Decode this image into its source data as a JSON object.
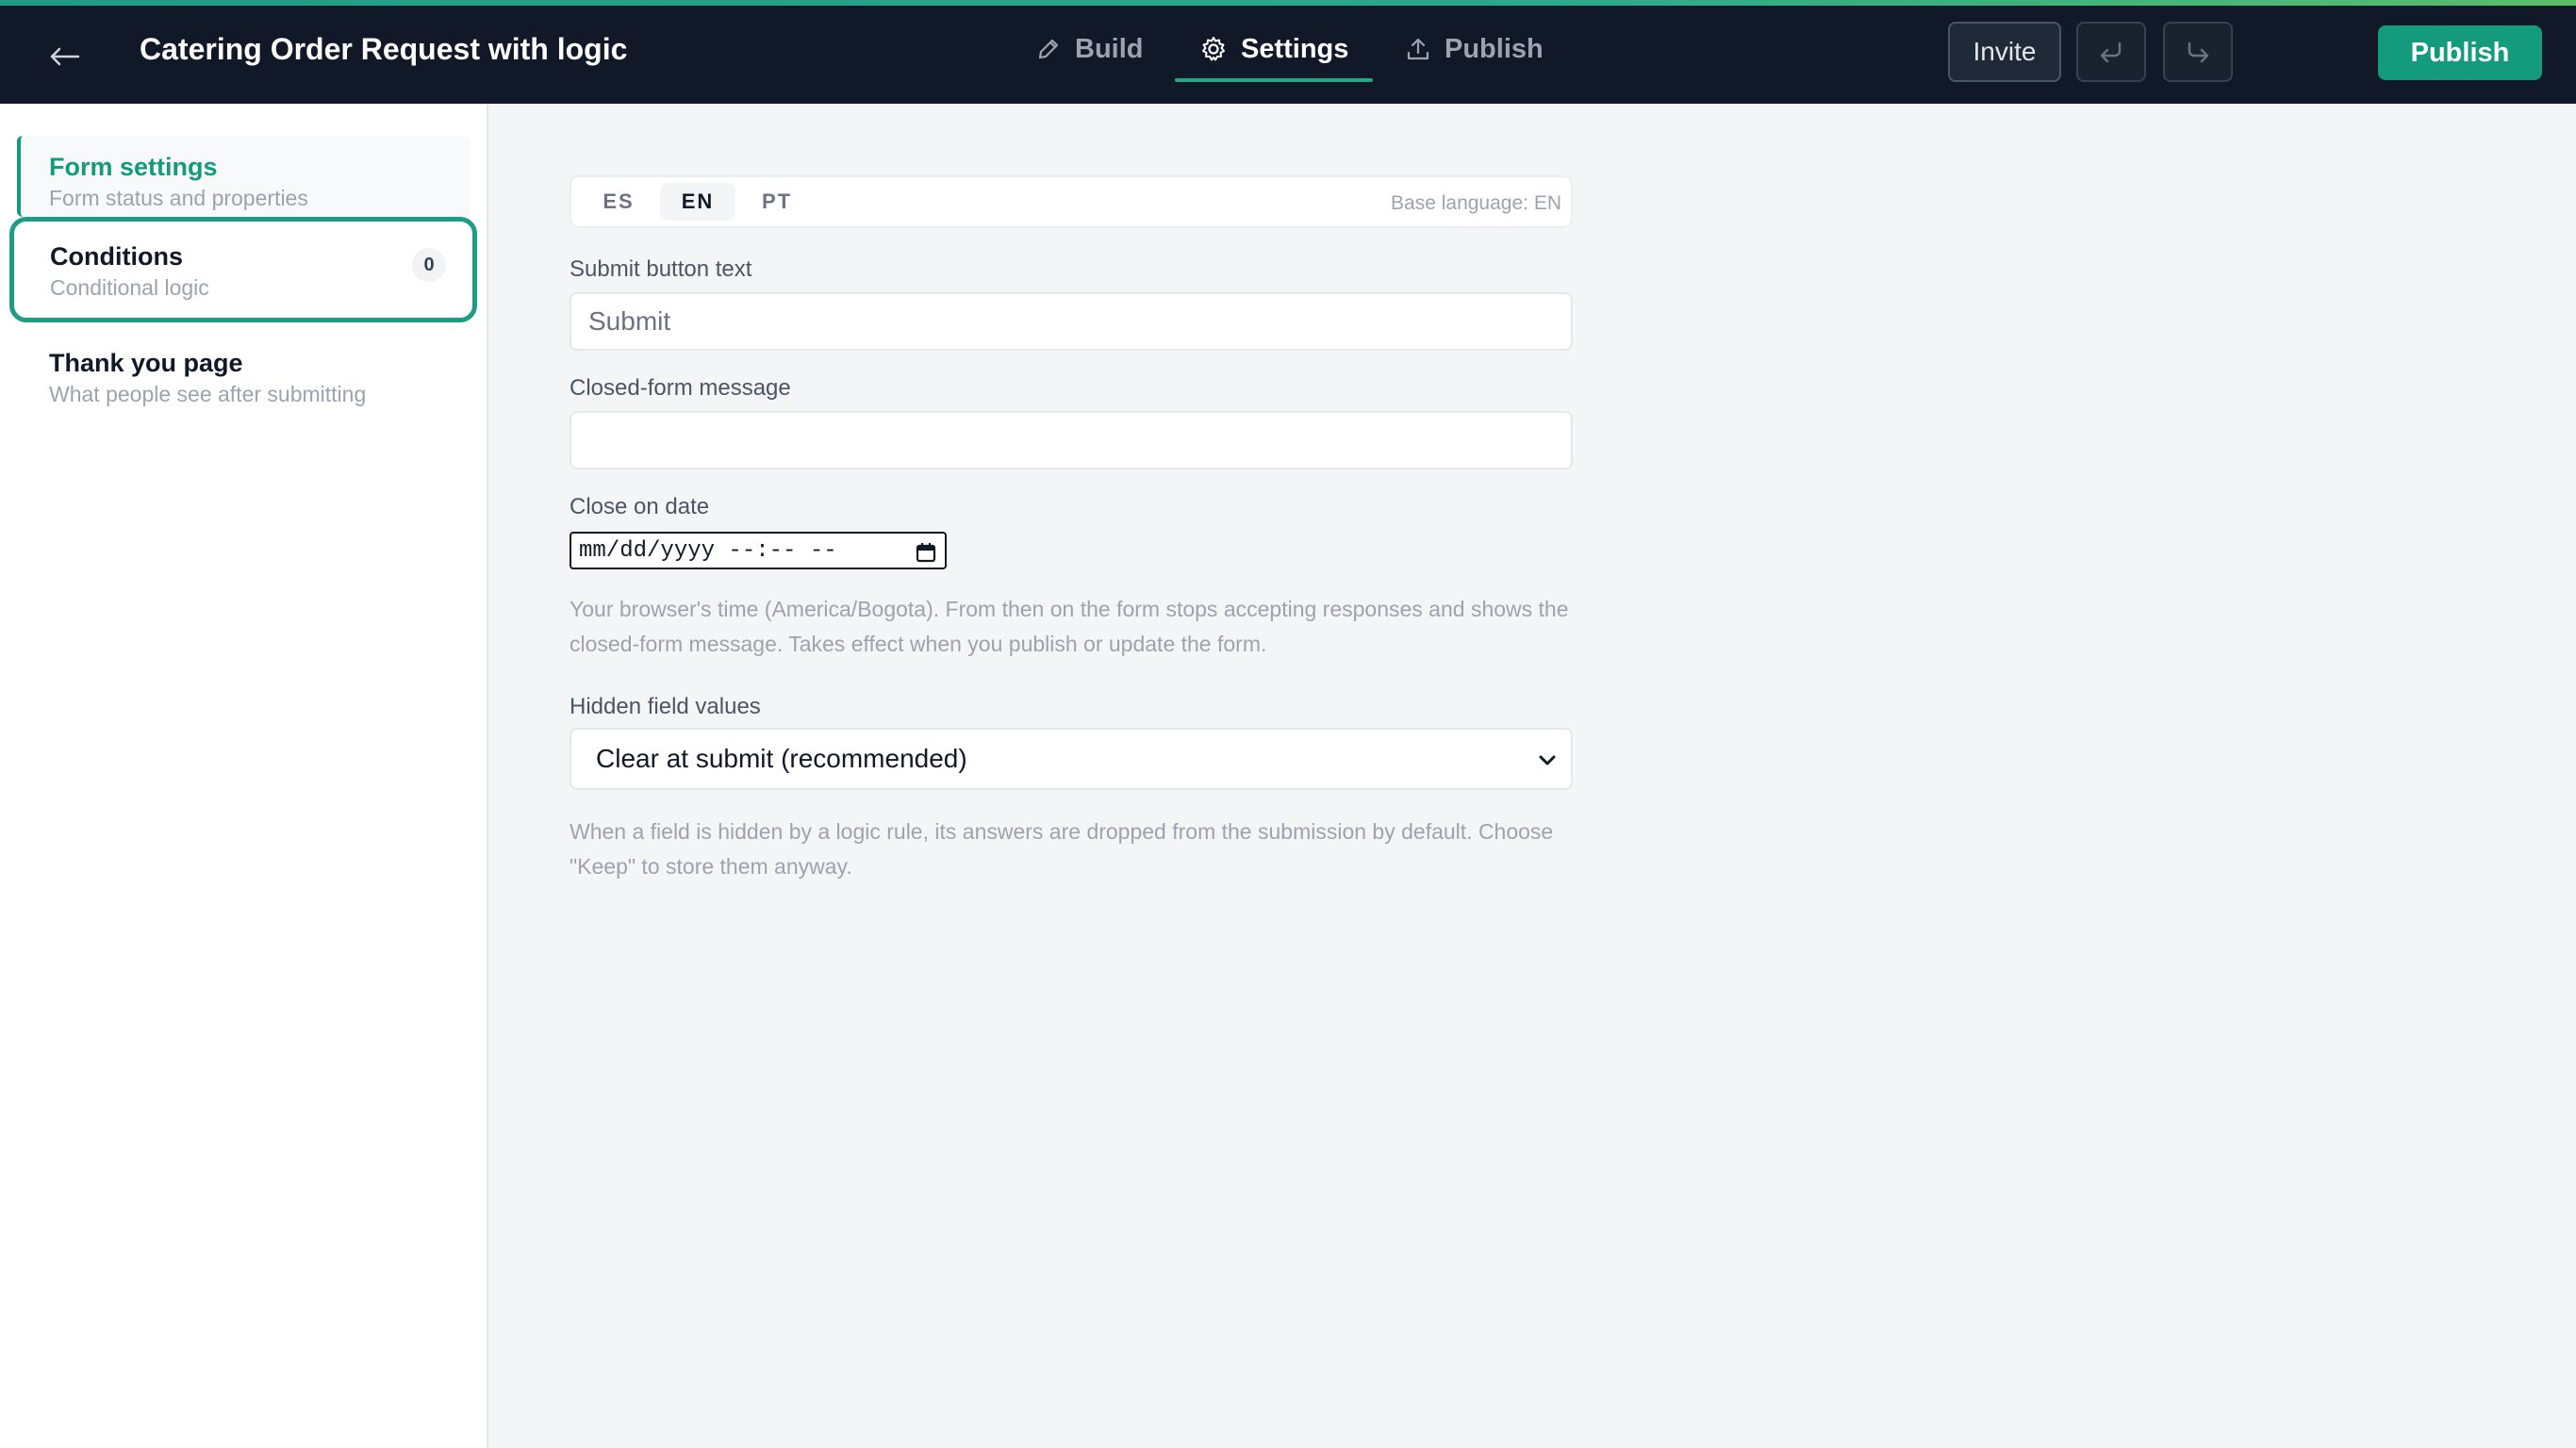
{
  "header": {
    "title": "Catering Order Request with logic",
    "tabs": [
      {
        "label": "Build",
        "icon": "pencil-icon"
      },
      {
        "label": "Settings",
        "icon": "gear-icon"
      },
      {
        "label": "Publish",
        "icon": "upload-icon"
      }
    ],
    "active_tab": "Settings",
    "invite_label": "Invite",
    "publish_label": "Publish"
  },
  "sidebar": {
    "items": [
      {
        "label": "Form settings",
        "sub": "Form status and properties"
      },
      {
        "label": "Conditions",
        "sub": "Conditional logic",
        "count": "0"
      },
      {
        "label": "Thank you page",
        "sub": "What people see after submitting"
      }
    ]
  },
  "languages": {
    "tabs": [
      "ES",
      "EN",
      "PT"
    ],
    "active": "EN",
    "base": "Base language: EN"
  },
  "settings": {
    "submit_label": "Submit button text",
    "submit_value": "Submit",
    "closed_label": "Closed-form message",
    "closed_value": "",
    "close_date_label": "Close on date",
    "close_date_value": "mm/dd/yyyy --:-- --",
    "close_date_help": "Your browser's time (America/Bogota). From then on the form stops accepting responses and shows the closed-form message. Takes effect when you publish or update the form.",
    "hidden_label": "Hidden field values",
    "hidden_value": "Clear at submit (recommended)",
    "hidden_help": "When a field is hidden by a logic rule, its answers are dropped from the submission by default. Choose \"Keep\" to store them anyway."
  },
  "colors": {
    "accent": "#149a7c",
    "topbar": "#111827",
    "highlight": "#1e9c86"
  }
}
